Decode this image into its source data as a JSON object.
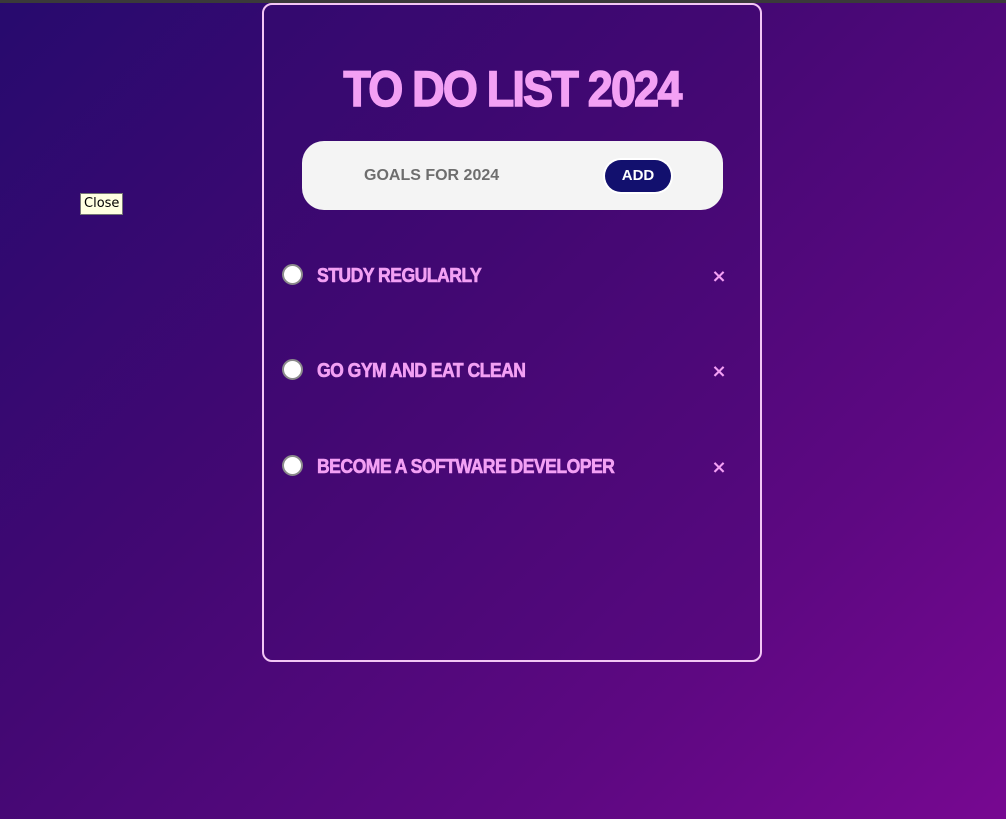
{
  "tooltip": {
    "text": "Close"
  },
  "app": {
    "title": "TO DO LIST 2024"
  },
  "input": {
    "placeholder": "GOALS FOR 2024",
    "value": ""
  },
  "add_button": {
    "label": "ADD"
  },
  "tasks": [
    {
      "label": "STUDY REGULARLY",
      "checked": false,
      "remove_icon": "×"
    },
    {
      "label": "GO GYM AND EAT CLEAN",
      "checked": false,
      "remove_icon": "×"
    },
    {
      "label": "BECOME A SOFTWARE DEVELOPER",
      "checked": false,
      "remove_icon": "×"
    }
  ],
  "colors": {
    "accent": "#f3a0f4",
    "button": "#12106e",
    "input_bg": "#f4f4f4",
    "bg_start": "#270a6e",
    "bg_end": "#770891"
  }
}
